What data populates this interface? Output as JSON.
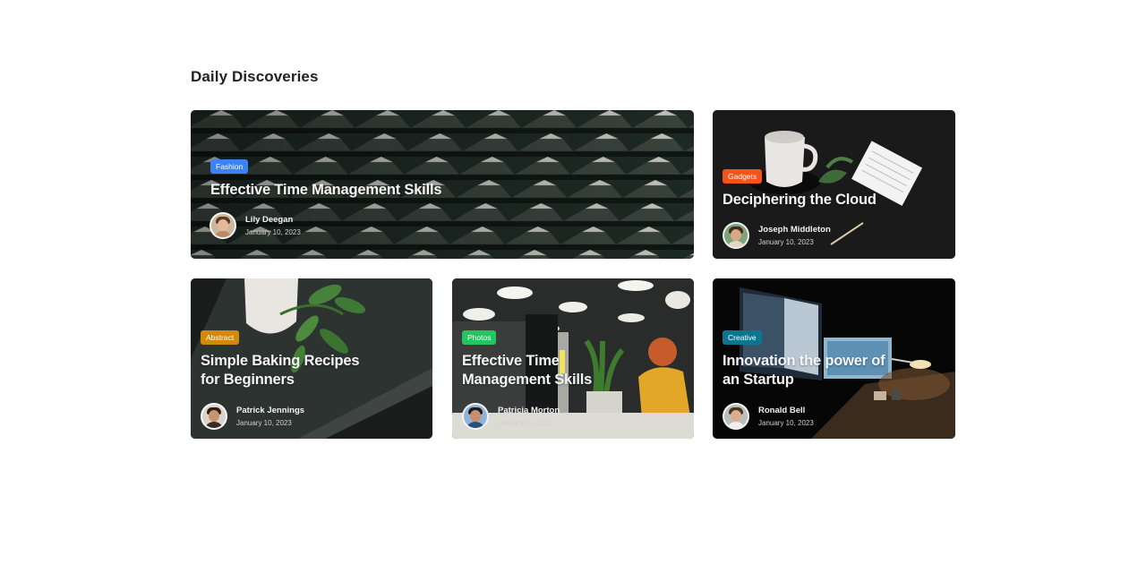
{
  "section": {
    "title": "Daily Discoveries"
  },
  "colors": {
    "fashion": "#3b82f6",
    "gadgets": "#f2541b",
    "abstract": "#d28a0c",
    "photos": "#22c55e",
    "creative": "#0e7490"
  },
  "cards": [
    {
      "category": "Fashion",
      "title": "Effective Time Management Skills",
      "author": "Lily Deegan",
      "date": "January 10, 2023",
      "image": "architecture-pattern"
    },
    {
      "category": "Gadgets",
      "title": "Deciphering the Cloud",
      "author": "Joseph Middleton",
      "date": "January 10, 2023",
      "image": "mug-notepad"
    },
    {
      "category": "Abstract",
      "title_lines": [
        "Simple Baking Recipes",
        "for Beginners"
      ],
      "author": "Patrick Jennings",
      "date": "January 10, 2023",
      "image": "book-plant"
    },
    {
      "category": "Photos",
      "title_lines": [
        "Effective Time",
        "Management Skills"
      ],
      "author": "Patricia Morton",
      "date": "January 10, 2023",
      "image": "office-woman"
    },
    {
      "category": "Creative",
      "title_lines": [
        "Innovation the power of",
        "an Startup"
      ],
      "author": "Ronald Bell",
      "date": "January 10, 2023",
      "image": "monitors-desk"
    }
  ]
}
